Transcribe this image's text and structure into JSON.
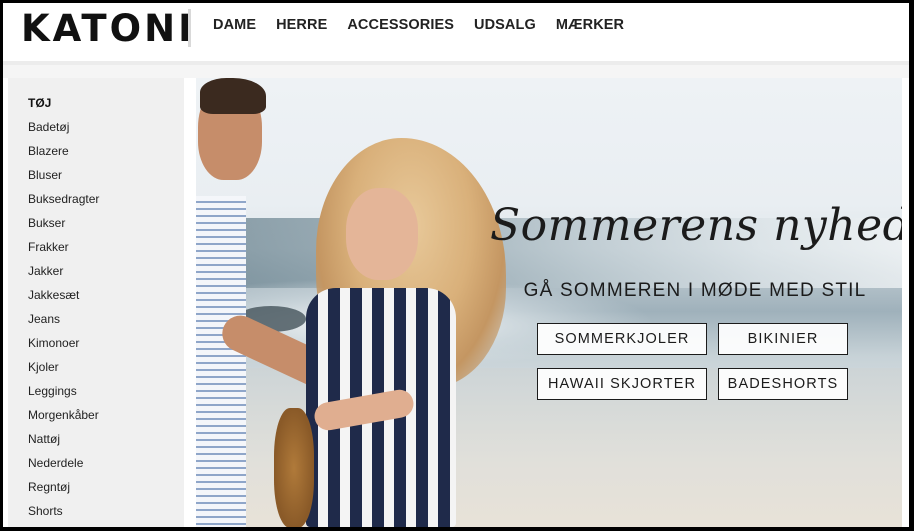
{
  "brand": {
    "logo_text": "KATONI"
  },
  "nav": {
    "items": [
      "DAME",
      "HERRE",
      "ACCESSORIES",
      "UDSALG",
      "MÆRKER"
    ]
  },
  "sidebar": {
    "title": "TØJ",
    "items": [
      "Badetøj",
      "Blazere",
      "Bluser",
      "Buksedragter",
      "Bukser",
      "Frakker",
      "Jakker",
      "Jakkesæt",
      "Jeans",
      "Kimonoer",
      "Kjoler",
      "Leggings",
      "Morgenkåber",
      "Nattøj",
      "Nederdele",
      "Regntøj",
      "Shorts"
    ]
  },
  "hero": {
    "headline": "Sommerens nyheder",
    "subheadline": "GÅ SOMMEREN I MØDE MED STIL",
    "buttons": [
      "SOMMERKJOLER",
      "BIKINIER",
      "HAWAII SKJORTER",
      "BADESHORTS"
    ]
  },
  "colors": {
    "text": "#1b1b1b",
    "sidebar_bg": "#f0f0f0",
    "header_rule": "#ececec"
  }
}
